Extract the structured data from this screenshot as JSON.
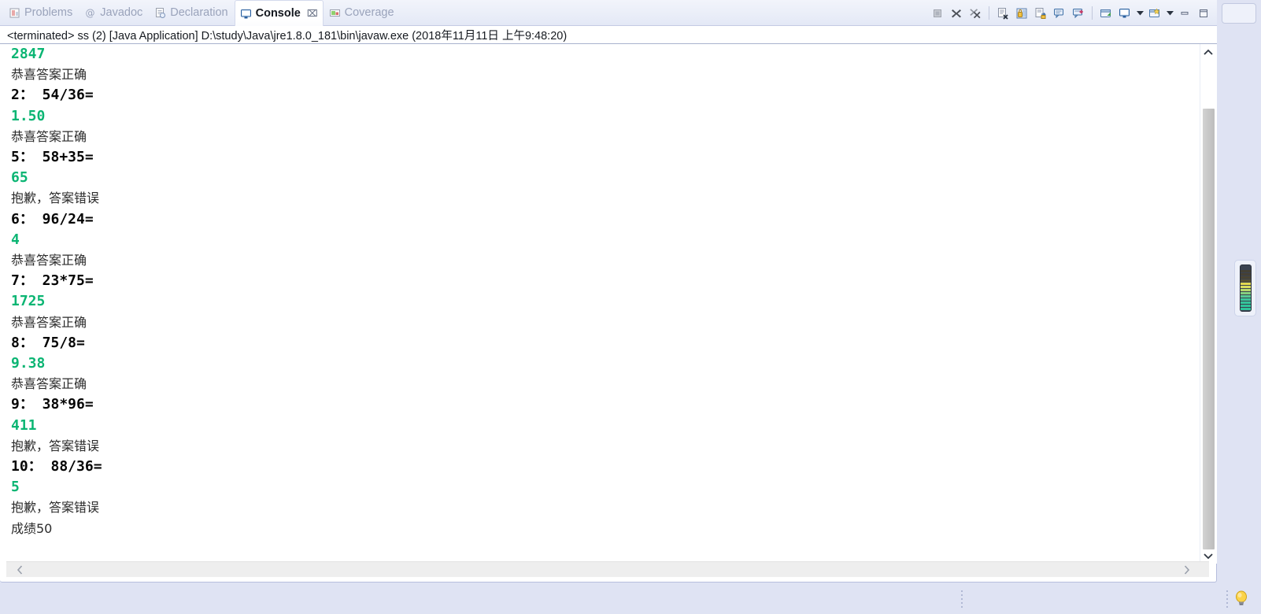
{
  "window": {
    "active_view": "Console"
  },
  "tabs": [
    {
      "label": "Problems",
      "icon": "problems-icon",
      "active": false
    },
    {
      "label": "Javadoc",
      "icon": "javadoc-icon",
      "active": false
    },
    {
      "label": "Declaration",
      "icon": "declaration-icon",
      "active": false
    },
    {
      "label": "Console",
      "icon": "console-icon",
      "active": true,
      "close_glyph": "⌧"
    },
    {
      "label": "Coverage",
      "icon": "coverage-icon",
      "active": false
    }
  ],
  "toolbar": {
    "buttons": [
      {
        "name": "terminate-button",
        "tooltip": "Terminate"
      },
      {
        "name": "remove-launch-button",
        "tooltip": "Remove Launch"
      },
      {
        "name": "remove-all-launches-button",
        "tooltip": "Remove All Terminated Launches"
      },
      {
        "name": "clear-console-button",
        "tooltip": "Clear Console"
      },
      {
        "name": "scroll-lock-button",
        "tooltip": "Scroll Lock"
      },
      {
        "name": "pin-console-button",
        "tooltip": "Pin Console"
      },
      {
        "name": "display-selected-console-button",
        "tooltip": "Display Selected Console"
      },
      {
        "name": "open-console-button",
        "tooltip": "Open Console"
      },
      {
        "name": "new-console-view-button",
        "tooltip": "New Console View"
      },
      {
        "name": "view-menu-button",
        "tooltip": "View Menu"
      },
      {
        "name": "minimize-button",
        "tooltip": "Minimize"
      },
      {
        "name": "maximize-button",
        "tooltip": "Maximize"
      }
    ]
  },
  "launch_config": {
    "text": "<terminated> ss (2) [Java Application] D:\\study\\Java\\jre1.8.0_181\\bin\\javaw.exe (2018年11月11日 上午9:48:20)"
  },
  "console": {
    "colors": {
      "stdout_green": "#0bb573",
      "question_black": "#050505",
      "message_gray": "#2b2b2b",
      "background": "#ffffff"
    },
    "lines": [
      {
        "text": "2847",
        "kind": "out"
      },
      {
        "text": "恭喜答案正确",
        "kind": "msg"
      },
      {
        "text": "2： 54/36=",
        "kind": "q"
      },
      {
        "text": "1.50",
        "kind": "out"
      },
      {
        "text": "恭喜答案正确",
        "kind": "msg"
      },
      {
        "text": "5： 58+35=",
        "kind": "q"
      },
      {
        "text": "65",
        "kind": "out"
      },
      {
        "text": "抱歉，答案错误",
        "kind": "msg"
      },
      {
        "text": "6： 96/24=",
        "kind": "q"
      },
      {
        "text": "4",
        "kind": "out"
      },
      {
        "text": "恭喜答案正确",
        "kind": "msg"
      },
      {
        "text": "7： 23*75=",
        "kind": "q"
      },
      {
        "text": "1725",
        "kind": "out"
      },
      {
        "text": "恭喜答案正确",
        "kind": "msg"
      },
      {
        "text": "8： 75/8=",
        "kind": "q"
      },
      {
        "text": "9.38",
        "kind": "out"
      },
      {
        "text": "恭喜答案正确",
        "kind": "msg"
      },
      {
        "text": "9： 38*96=",
        "kind": "q"
      },
      {
        "text": "411",
        "kind": "out"
      },
      {
        "text": "抱歉，答案错误",
        "kind": "msg"
      },
      {
        "text": "10： 88/36=",
        "kind": "q"
      },
      {
        "text": "5",
        "kind": "out"
      },
      {
        "text": "抱歉，答案错误",
        "kind": "msg"
      },
      {
        "text": "成绩50",
        "kind": "msg"
      }
    ]
  },
  "scrollbars": {
    "vertical": {
      "up_glyph": "⌃",
      "down_glyph": "⌄"
    },
    "horizontal": {
      "left_glyph": "‹",
      "right_glyph": "›"
    }
  },
  "status_bar": {
    "heap_indicator_name": "heap-monitor",
    "tip_icon_name": "lightbulb-icon"
  }
}
